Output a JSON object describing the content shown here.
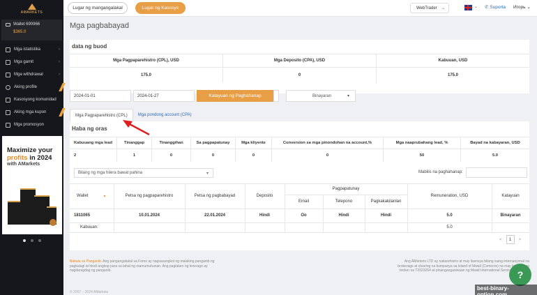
{
  "brand": {
    "logo_text": "AMARKETS"
  },
  "wallet": {
    "label": "Wallet 690966",
    "amount": "$365.0"
  },
  "sidebar": {
    "items": [
      {
        "label": "Mga istatistika",
        "chevron": true
      },
      {
        "label": "Mga gamit",
        "chevron": true
      },
      {
        "label": "Mga withdrawal",
        "chevron": true
      },
      {
        "label": "Aking profile",
        "chevron": false
      },
      {
        "label": "Kasosyong komunidad",
        "chevron": false
      },
      {
        "label": "Aking mga kupon",
        "chevron": false
      },
      {
        "label": "Mga promosyon",
        "chevron": false
      }
    ]
  },
  "promo": {
    "line1": "Maximize your",
    "line2a": "profits",
    "line2b": " in 2024",
    "line3": "with AMarkets"
  },
  "topbar": {
    "personal_tab": "Lugar ng mangangalakal",
    "affiliate_tab": "Lugar ng Kasosyo",
    "webtrader": "WebTrader",
    "support": "Suporta",
    "user": "Игорь"
  },
  "page": {
    "title": "Mga pagbabayad"
  },
  "summary": {
    "title": "data ng buod",
    "headers": [
      "Mga Pagpaparehistro (CPL), USD",
      "Mga Deposito (CPA), USD",
      "Kabuuan, USD"
    ],
    "values": [
      "175.0",
      "0",
      "175.0"
    ]
  },
  "filters": {
    "date_from": "2024-01-01",
    "date_to": "2024-01-27",
    "apply_label": "Katayuan ng Paghahanap",
    "status_value": "Binayaran"
  },
  "tabs": {
    "active": "Mga Pagpaparehistro (CPL)",
    "other": "Mga pondong account (CPA)"
  },
  "period": {
    "title": "Haba ng oras",
    "headers": [
      "Kabuuang mga lead",
      "Tinanggap",
      "Tinanggihan",
      "Sa pagpapatunay",
      "Mga kliyente",
      "Conversion sa mga pinondohan na account,%",
      "Mga naaprubahang lead, %",
      "Bayad na kabayaran, USD"
    ],
    "values": [
      "2",
      "1",
      "0",
      "0",
      "0",
      "0",
      "50",
      "5.0"
    ]
  },
  "detail": {
    "rows_per_page": "Bilang ng mga hilera bawat pahina",
    "search_label": "Mabilis na paghahanap:",
    "headers": {
      "wallet": "Wallet",
      "reg_date": "Petsa ng pagpaparehistro",
      "pay_date": "Petsa ng pagbabayad",
      "deposit": "Deposito",
      "verification": "Pagpapatunay",
      "email": "Email",
      "phone": "Telepono",
      "identity": "Pagkakakilanlan",
      "remuneration": "Remuneration, USD",
      "status": "Katayuan"
    },
    "row": {
      "wallet": "1811065",
      "reg_date": "10.01.2024",
      "pay_date": "22.01.2024",
      "deposit": "Hindi",
      "email": "Oo",
      "phone": "Hindi",
      "identity": "Hindi",
      "remuneration": "5.0",
      "status": "Binayaran"
    },
    "total_label": "Kabuuan:",
    "total_value": "5.0",
    "pager": {
      "prev": "<",
      "page": "1",
      "next": ">"
    }
  },
  "footer": {
    "left_warn": "Babala sa Panganib:",
    "left_text": " Ang pangangalakal sa Forex ay nagsasangkot ng malaking panganib ng pagkalugi at hindi angkop para sa lahat ng mamumuhunan. Ang paglalaro ng leverage ay nagdaragdag ng panganib.",
    "right_text": "Ang AMarkets LTD ay nakarehistro at may lisensya bilang isang internasyonal na brokerage at clearing na kumpanya sa Island of Mwali (Comoros) na may lisensya ng broker na T2023264 at pinangangasiwaan ng Mwali International Services Authority.",
    "copyright": "© 2007 – 2024 AMarkets"
  },
  "help": {
    "icon": "?"
  },
  "watermark": {
    "text": "best-binary-option.com"
  }
}
